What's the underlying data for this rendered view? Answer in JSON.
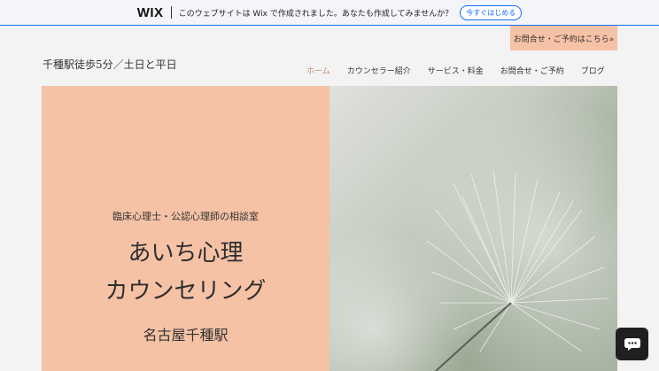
{
  "banner": {
    "logo": "WIX",
    "message": "このウェブサイトは Wix で作成されました。あなたも作成してみませんか？",
    "cta": "今すぐはじめる"
  },
  "contact_tab": {
    "label": "お問合せ・ご予約はこちら»"
  },
  "header": {
    "site_title": "千種駅徒歩5分／土日と平日",
    "nav": [
      {
        "label": "ホーム",
        "active": true
      },
      {
        "label": "カウンセラー紹介",
        "active": false
      },
      {
        "label": "サービス・料金",
        "active": false
      },
      {
        "label": "お問合せ・ご予約",
        "active": false
      },
      {
        "label": "ブログ",
        "active": false
      }
    ]
  },
  "hero": {
    "subtitle": "臨床心理士・公認心理師の相談室",
    "title_line1": "あいち心理",
    "title_line2": "カウンセリング",
    "location": "名古屋千種駅"
  },
  "chat": {
    "icon": "chat-bubble-icon"
  },
  "colors": {
    "accent": "#f6c2a6",
    "wix_blue": "#116dff",
    "nav_active": "#c08a6c"
  }
}
